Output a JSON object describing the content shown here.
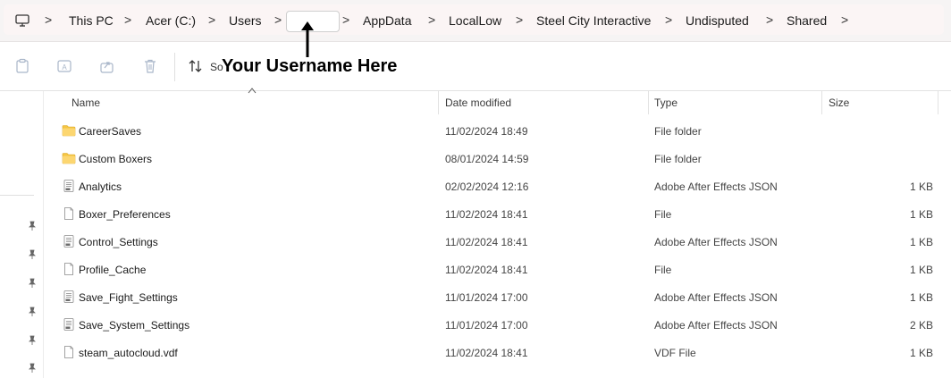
{
  "breadcrumb": {
    "items": [
      "This PC",
      "Acer (C:)",
      "Users",
      "",
      "AppData",
      "LocalLow",
      "Steel City Interactive",
      "Undisputed",
      "Shared"
    ],
    "separator": ">"
  },
  "toolbar": {
    "sort_label": "So"
  },
  "annotation": {
    "text": "Your Username Here"
  },
  "columns": {
    "name": "Name",
    "date_modified": "Date modified",
    "type": "Type",
    "size": "Size"
  },
  "files": [
    {
      "name": "CareerSaves",
      "date": "11/02/2024 18:49",
      "type": "File folder",
      "size": "",
      "icon": "folder-icon"
    },
    {
      "name": "Custom Boxers",
      "date": "08/01/2024 14:59",
      "type": "File folder",
      "size": "",
      "icon": "folder-icon"
    },
    {
      "name": "Analytics",
      "date": "02/02/2024 12:16",
      "type": "Adobe After Effects JSON",
      "size": "1 KB",
      "icon": "json-file-icon"
    },
    {
      "name": "Boxer_Preferences",
      "date": "11/02/2024 18:41",
      "type": "File",
      "size": "1 KB",
      "icon": "file-icon"
    },
    {
      "name": "Control_Settings",
      "date": "11/02/2024 18:41",
      "type": "Adobe After Effects JSON",
      "size": "1 KB",
      "icon": "json-file-icon"
    },
    {
      "name": "Profile_Cache",
      "date": "11/02/2024 18:41",
      "type": "File",
      "size": "1 KB",
      "icon": "file-icon"
    },
    {
      "name": "Save_Fight_Settings",
      "date": "11/01/2024 17:00",
      "type": "Adobe After Effects JSON",
      "size": "1 KB",
      "icon": "json-file-icon"
    },
    {
      "name": "Save_System_Settings",
      "date": "11/01/2024 17:00",
      "type": "Adobe After Effects JSON",
      "size": "2 KB",
      "icon": "json-file-icon"
    },
    {
      "name": "steam_autocloud.vdf",
      "date": "11/02/2024 18:41",
      "type": "VDF File",
      "size": "1 KB",
      "icon": "file-icon"
    }
  ],
  "colors": {
    "folder": "#f5c542",
    "address_bg": "#fbf5f5"
  }
}
